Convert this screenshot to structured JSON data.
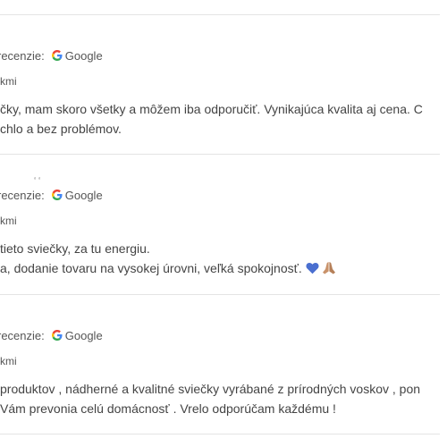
{
  "reviews": [
    {
      "source_label": "recenzie:",
      "source_name": "Google",
      "meta": "kmi",
      "lines": [
        "čky, mam skoro všetky a môžem iba odporučiť. Vynikajúca kvalita aj cena. C",
        "chlo a bez problémov."
      ]
    },
    {
      "tick": "‘ ‘",
      "source_label": "recenzie:",
      "source_name": "Google",
      "meta": "kmi",
      "lines": [
        "tieto sviečky, za tu energiu.",
        "a, dodanie tovaru na vysokej úrovni, veľká spokojnosť."
      ],
      "emojis": [
        "blue-heart-icon",
        "folded-hands-icon"
      ]
    },
    {
      "source_label": "recenzie:",
      "source_name": "Google",
      "meta": "kmi",
      "lines": [
        " produktov , nádherné a kvalitné sviečky vyrábané z prírodných voskov , pon",
        "Vám prevonia celú domácnosť . Vrelo odporúčam každému !"
      ]
    }
  ],
  "colors": {
    "google_blue": "#4285F4",
    "google_red": "#EA4335",
    "google_yellow": "#FBBC05",
    "google_green": "#34A853",
    "heart_blue": "#4a6fd0",
    "hands_tan": "#c9926a",
    "divider": "#e4e4e4"
  }
}
